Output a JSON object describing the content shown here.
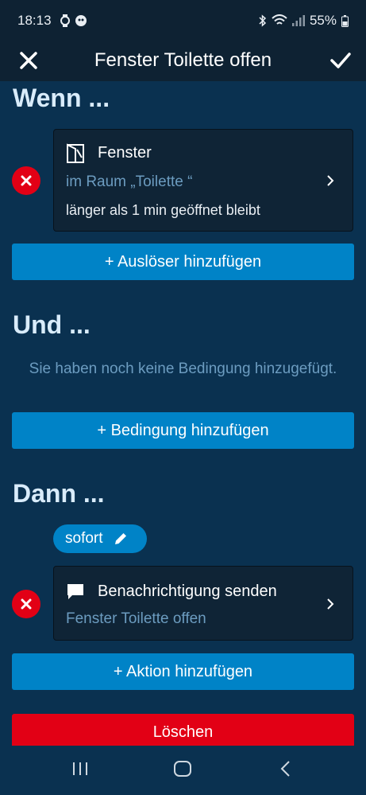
{
  "status_bar": {
    "time": "18:13",
    "battery": "55%"
  },
  "header": {
    "title": "Fenster Toilette offen",
    "close_icon": "close-icon",
    "confirm_icon": "check-icon"
  },
  "when": {
    "heading": "Wenn ...",
    "trigger": {
      "title": "Fenster",
      "room": "im Raum „Toilette “",
      "condition": "länger als 1 min geöffnet bleibt"
    },
    "add_button": "+ Auslöser hinzufügen"
  },
  "and": {
    "heading": "Und ...",
    "empty_text": "Sie haben noch keine Bedingung hinzugefügt.",
    "add_button": "+ Bedingung hinzufügen"
  },
  "then": {
    "heading": "Dann ...",
    "timing_chip": "sofort",
    "action": {
      "title": "Benachrichtigung senden",
      "detail": "Fenster Toilette offen"
    },
    "add_button": "+ Aktion hinzufügen"
  },
  "delete_button": "Löschen",
  "colors": {
    "background": "#0a3150",
    "card": "#0f2436",
    "accent_blue": "#0083c7",
    "danger_red": "#e20015",
    "heading": "#d9ecfb",
    "muted_text": "#6c9cc0"
  }
}
